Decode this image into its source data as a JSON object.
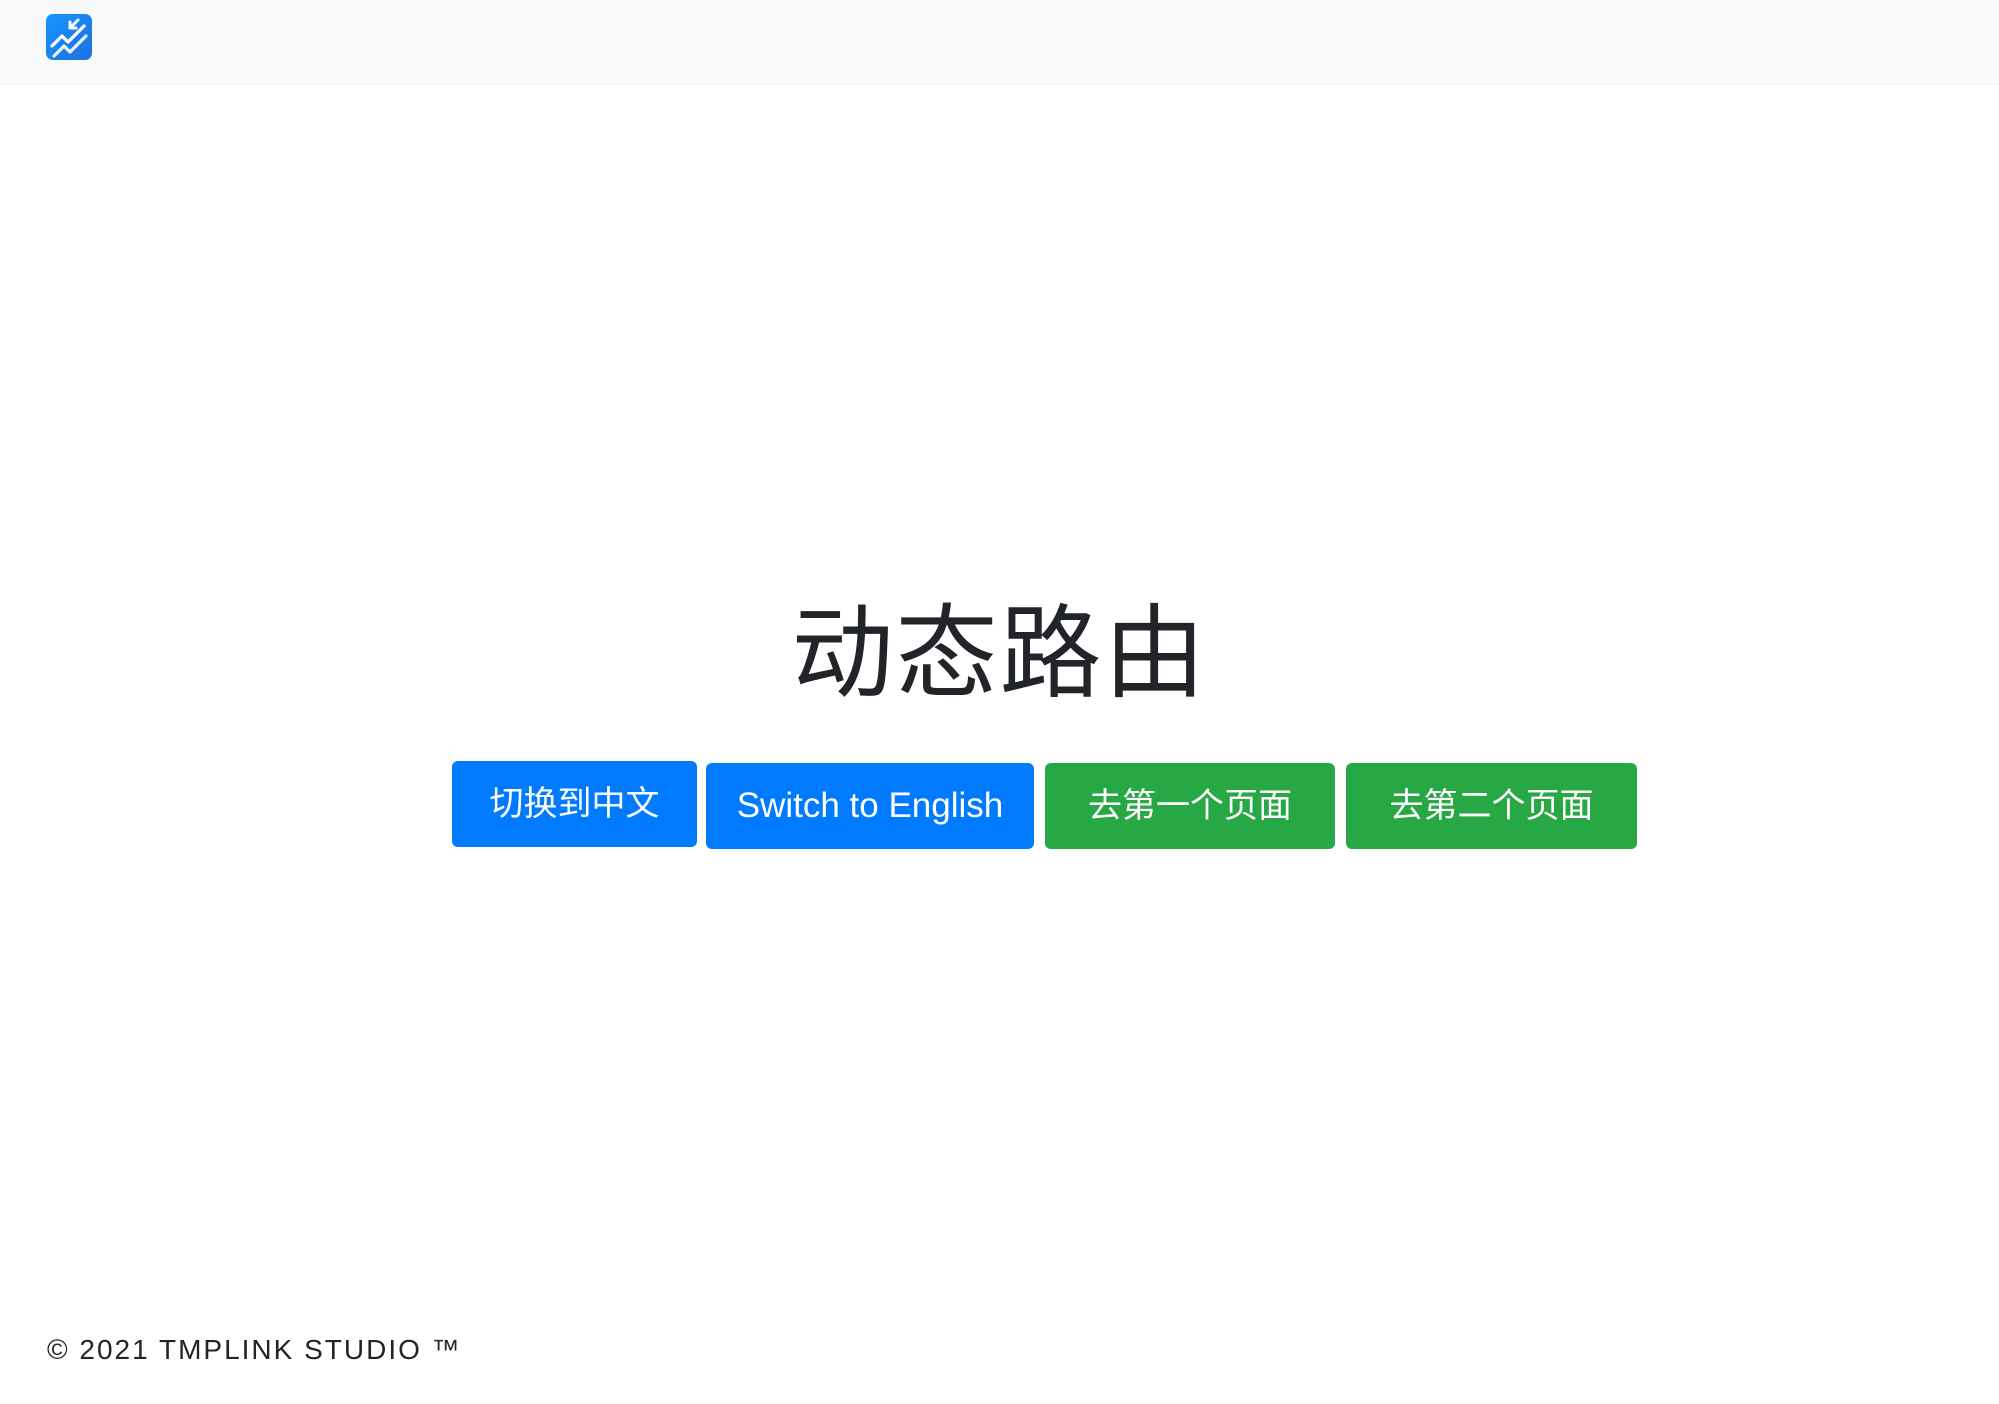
{
  "navbar": {
    "logo_icon": "route-arrows-logo-icon",
    "logo_color": "#1a8cff"
  },
  "main": {
    "title": "动态路由"
  },
  "buttons": {
    "switch_chinese": "切换到中文",
    "switch_english": "Switch to English",
    "go_first_page": "去第一个页面",
    "go_second_page": "去第二个页面"
  },
  "colors": {
    "primary": "#007bff",
    "success": "#28a745",
    "navbar_bg": "#f8f9fa",
    "text": "#212529"
  },
  "footer": {
    "text": "© 2021 TMPLINK STUDIO ™"
  }
}
